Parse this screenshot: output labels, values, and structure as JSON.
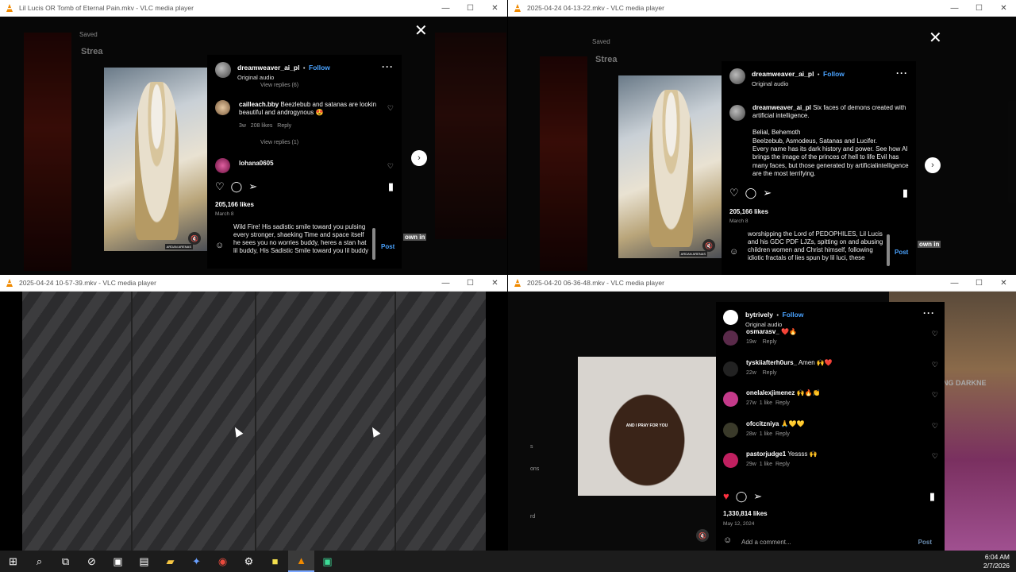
{
  "windows": {
    "tl": {
      "title": "Lil Lucis OR Tomb of Eternal Pain.mkv - VLC media player",
      "saved_label": "Saved",
      "stream_label": "Strea",
      "user": "dreamweaver_ai_pl",
      "follow": "Follow",
      "audio": "Original audio",
      "view_replies_1": "View replies (6)",
      "comment1_user": "cailleach.bby",
      "comment1_text": "Beezlebub and satanas are lookin beautiful and androgynous 😍",
      "comment1_meta_time": "3w",
      "comment1_meta_likes": "208 likes",
      "comment1_meta_reply": "Reply",
      "view_replies_2": "View replies (1)",
      "comment2_user": "lohana0605",
      "likes": "205,166 likes",
      "date": "March 8",
      "composer": "Wild Fire! His sadistic smile toward you pulsing every stronger, shaeking Time and space itself he sees you no worries buddy, heres a stan hat lil buddy, His Sadistic Smile toward you lil buddy",
      "post": "Post",
      "watermark": "ARDAN ARENAS"
    },
    "tr": {
      "title": "2025-04-24 04-13-22.mkv - VLC media player",
      "saved_label": "Saved",
      "stream_label": "Strea",
      "user": "dreamweaver_ai_pl",
      "follow": "Follow",
      "audio": "Original audio",
      "caption_user": "dreamweaver_ai_pl",
      "caption_line1": "Six faces of demons created with artificial intelligence.",
      "caption_line2": "Belial, Behemoth",
      "caption_line3": "Beelzebub, Asmodeus, Satanas and Lucifer.",
      "caption_line4": "Every name has its dark history and power. See how AI brings the image of the princes of hell to life Evil has many faces, but those generated by artificialintelligence are the most terrifying.",
      "likes": "205,166 likes",
      "date": "March 8",
      "composer": "worshipping the Lord of PEDOPHILES, Lil Lucis and his GDC PDF LJZs, spitting on and abusing children women and Christ himself, following idiotic fractals of lies spun by lil luci, these",
      "post": "Post",
      "watermark": "ARDAN ARENAS"
    },
    "bl": {
      "title": "2025-04-24 10-57-39.mkv - VLC media player"
    },
    "br": {
      "title": "2025-04-20 06-36-48.mkv - VLC media player",
      "user": "bytrively",
      "follow": "Follow",
      "audio": "Original audio",
      "caption_overlay": "AND I PRAY FOR YOU",
      "comments": [
        {
          "user": "osmarasv_",
          "text": "❤️🔥",
          "time": "19w",
          "likes": "",
          "reply": "Reply"
        },
        {
          "user": "tyskiiafterh0urs_",
          "text": "Amen 🙌❤️",
          "time": "22w",
          "likes": "",
          "reply": "Reply"
        },
        {
          "user": "onelalexjimenez",
          "text": "🙌🔥👏",
          "time": "27w",
          "likes": "1 like",
          "reply": "Reply"
        },
        {
          "user": "ofccitzniya",
          "text": "🙏💛💛",
          "time": "28w",
          "likes": "1 like",
          "reply": "Reply"
        },
        {
          "user": "pastorjudge1",
          "text": "Yessss 🙌",
          "time": "29w",
          "likes": "1 like",
          "reply": "Reply"
        }
      ],
      "likes": "1,330,814 likes",
      "date": "May 12, 2024",
      "composer_placeholder": "Add a comment...",
      "post": "Post",
      "side_text_1": "s",
      "side_text_2": "ons",
      "side_text_3": "rd",
      "right_bg_text": "NG DARKNE"
    }
  },
  "taskbar": {
    "time": "6:04 AM",
    "date": "2/7/2026"
  },
  "colors": {
    "accent": "#4aa3ff",
    "like_red": "#ff3040"
  }
}
